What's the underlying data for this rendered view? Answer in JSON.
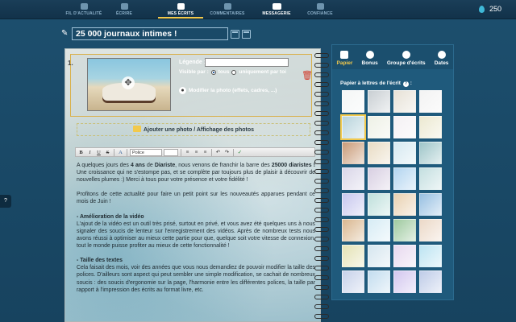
{
  "nav": {
    "items": [
      {
        "label": "Fil d'actualité",
        "active": false
      },
      {
        "label": "Écrire",
        "active": false
      },
      {
        "label": "Mes écrits",
        "active": true
      },
      {
        "label": "Commentaires",
        "active": false
      },
      {
        "label": "Messagerie",
        "active": false
      },
      {
        "label": "Confiance",
        "active": false
      }
    ],
    "credits": "250",
    "credits_icon": "drop-icon"
  },
  "title": "25 000 journaux intimes !",
  "block": {
    "number": "1.",
    "legend_label": "Légende :",
    "legend_value": "",
    "visible_label": "Visible par :",
    "visible_opt_all": "tous",
    "visible_opt_me": "uniquement par toi",
    "modify_label": "Modifier la photo (effets, cadres, ...)"
  },
  "add_photo": "Ajouter une photo / Affichage des photos",
  "toolbar": {
    "font_select": "Police"
  },
  "body_text": {
    "p1_a": "A quelques jours des ",
    "p1_b": "4 ans",
    "p1_c": " de ",
    "p1_d": "Diariste",
    "p1_e": ", nous venons de franchir la barre des ",
    "p1_f": "25000 diaristes !",
    "p1_g": " Une croissance qui ne s'estompe pas, et se complète par toujours plus de plaisir à découvrir de nouvelles plumes :) Merci à tous pour votre présence et votre fidélité !",
    "p2": "Profitons de cette actualité pour faire un petit point sur les nouveautés apparues pendant ce mois de Juin !",
    "h1": "- Amélioration de la vidéo",
    "p3": "L'ajout de la vidéo est un outil très prisé, surtout en privé, et vous avez été quelques uns à nous signaler des soucis de lenteur sur l'enregistrement des vidéos. Après de nombreux tests nous avons réussi à optimiser au mieux cette partie pour que, quelque soit votre vitesse de connexion, tout le monde puisse profiter au mieux de cette fonctionnalité !",
    "h2": "- Taille des textes",
    "p4": "Cela faisait des mois, voir des années que vous nous demandiez de pouvoir modifier la taille des polices. D'ailleurs sont aspect qui peut sembler une simple modification, se cachait de nombreux soucis : des soucis d'ergonomie sur la page, l'harmonie entre les différentes polices, la taille par rapport à l'impression des écrits au format livre, etc."
  },
  "side": {
    "tabs": [
      {
        "label": "Papier",
        "active": true,
        "icon": "leaf-icon"
      },
      {
        "label": "Bonus",
        "active": false,
        "icon": "palette-icon"
      },
      {
        "label": "Groupe d'écrits",
        "active": false,
        "icon": "books-icon"
      },
      {
        "label": "Dates",
        "active": false,
        "icon": "arrow-right-icon"
      }
    ],
    "subtitle": "Papier à lettres de l'écrit",
    "tiles": [
      "#f4f6f6",
      "#c9cfd3",
      "#e7e2d7",
      "#f3f3f3",
      "#b8d4dc",
      "#eef1e6",
      "#f4f1f4",
      "#ece9d1",
      "#c99b78",
      "#e9dcc4",
      "#d6e9f1",
      "#9fc6c9",
      "#d9d6e8",
      "#d8cfe2",
      "#b3d5f0",
      "#c4dfe0",
      "#c7c7ee",
      "#bfe0dc",
      "#e9d1b1",
      "#98c0e2",
      "#d9b790",
      "#d7ecf5",
      "#9fcaa0",
      "#ecd9c8",
      "#e4e2b5",
      "#d6e6ef",
      "#e8d9ef",
      "#bde4f2",
      "#c7d2ea",
      "#c3ddef",
      "#d3c7ef",
      "#bfcce8"
    ]
  }
}
